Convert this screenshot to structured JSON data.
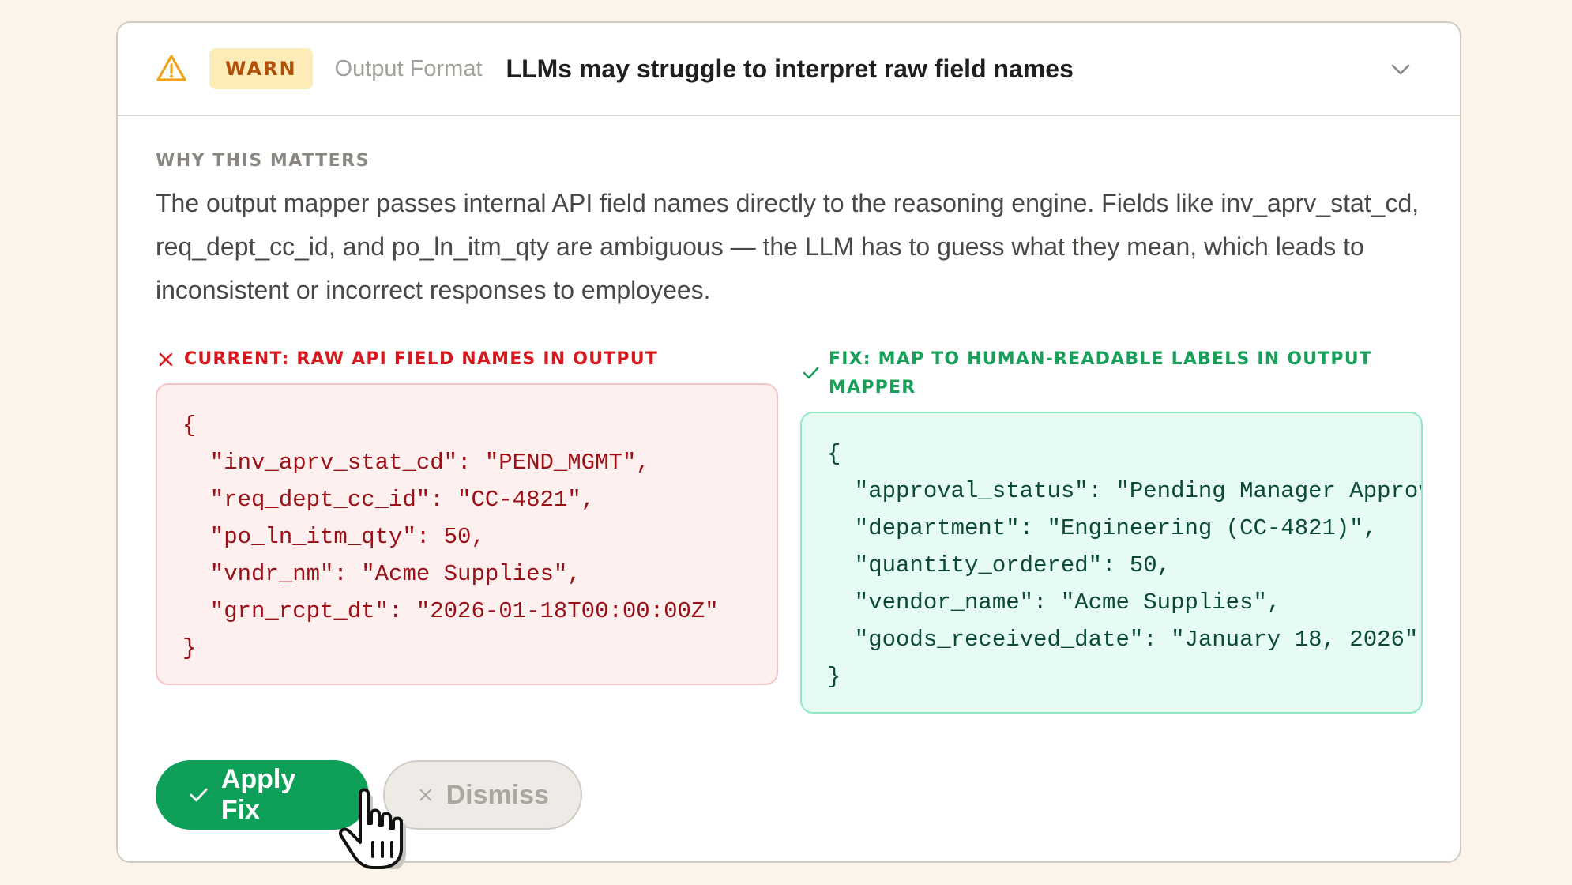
{
  "header": {
    "severity_icon": "warning-triangle-icon",
    "badge": "WARN",
    "category": "Output Format",
    "title": "LLMs may struggle to interpret raw field names",
    "expand_icon": "chevron-down-icon"
  },
  "explanation": {
    "label": "WHY THIS MATTERS",
    "text": "The output mapper passes internal API field names directly to the reasoning engine. Fields like inv_aprv_stat_cd, req_dept_cc_id, and po_ln_itm_qty are ambiguous — the LLM has to guess what they mean, which leads to inconsistent or incorrect responses to employees."
  },
  "current": {
    "icon": "x-icon",
    "label": "CURRENT: RAW API FIELD NAMES IN OUTPUT",
    "code": "{\n  \"inv_aprv_stat_cd\": \"PEND_MGMT\",\n  \"req_dept_cc_id\": \"CC-4821\",\n  \"po_ln_itm_qty\": 50,\n  \"vndr_nm\": \"Acme Supplies\",\n  \"grn_rcpt_dt\": \"2026-01-18T00:00:00Z\"\n}"
  },
  "fix": {
    "icon": "check-icon",
    "label": "FIX: MAP TO HUMAN-READABLE LABELS IN OUTPUT MAPPER",
    "code": "{\n  \"approval_status\": \"Pending Manager Approval\",\n  \"department\": \"Engineering (CC-4821)\",\n  \"quantity_ordered\": 50,\n  \"vendor_name\": \"Acme Supplies\",\n  \"goods_received_date\": \"January 18, 2026\"\n}"
  },
  "actions": {
    "apply_label": "Apply Fix",
    "dismiss_label": "Dismiss"
  },
  "colors": {
    "background": "#fcf4e8",
    "warn_badge_bg": "#fdecb8",
    "warn_badge_text": "#b3500a",
    "error_red": "#d7191f",
    "success_green": "#0e9f58"
  }
}
